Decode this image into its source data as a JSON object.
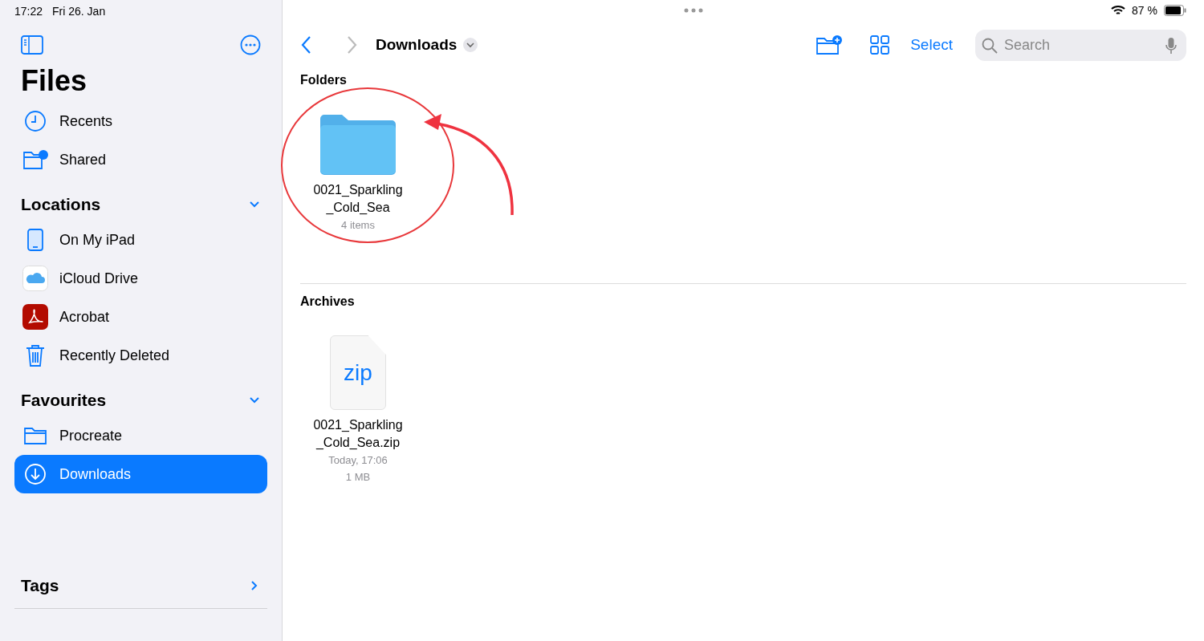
{
  "status_bar": {
    "time": "17:22",
    "date": "Fri 26. Jan",
    "battery": "87 %"
  },
  "sidebar": {
    "title": "Files",
    "top_items": [
      {
        "label": "Recents",
        "selected": false
      },
      {
        "label": "Shared",
        "selected": false
      }
    ],
    "sections": [
      {
        "title": "Locations",
        "expanded": true,
        "items": [
          {
            "label": "On My iPad",
            "selected": false
          },
          {
            "label": "iCloud Drive",
            "selected": false
          },
          {
            "label": "Acrobat",
            "selected": false
          },
          {
            "label": "Recently Deleted",
            "selected": false
          }
        ]
      },
      {
        "title": "Favourites",
        "expanded": true,
        "items": [
          {
            "label": "Procreate",
            "selected": false
          },
          {
            "label": "Downloads",
            "selected": true
          }
        ]
      },
      {
        "title": "Tags",
        "expanded": false
      }
    ]
  },
  "toolbar": {
    "title": "Downloads",
    "select": "Select",
    "search": {
      "placeholder": "Search"
    }
  },
  "groups": [
    {
      "title": "Folders",
      "kind": "folder",
      "items": [
        {
          "name_lines": [
            "0021_Sparkling",
            "_Cold_Sea"
          ],
          "details": [
            "4 items"
          ],
          "highlighted": true
        }
      ]
    },
    {
      "title": "Archives",
      "kind": "zip",
      "items": [
        {
          "name_lines": [
            "0021_Sparkling",
            "_Cold_Sea.zip"
          ],
          "details": [
            "Today, 17:06",
            "1 MB"
          ],
          "highlighted": false,
          "badge": "zip"
        }
      ]
    }
  ]
}
